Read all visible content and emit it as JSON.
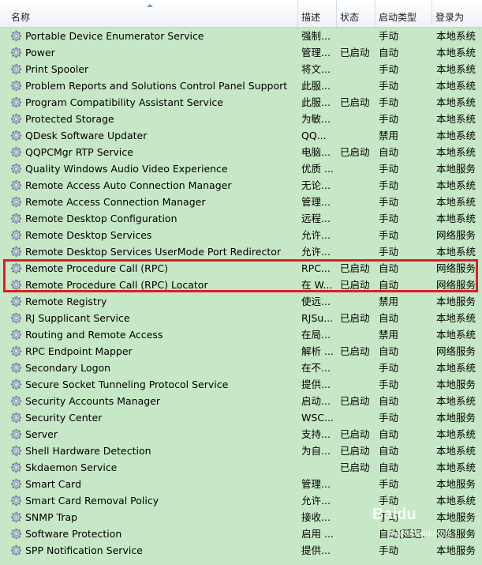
{
  "columns": {
    "name": "名称",
    "desc": "描述",
    "status": "状态",
    "startup": "启动类型",
    "logon": "登录为"
  },
  "rows": [
    {
      "name": "Portable Device Enumerator Service",
      "desc": "强制...",
      "status": "",
      "startup": "手动",
      "logon": "本地系统"
    },
    {
      "name": "Power",
      "desc": "管理...",
      "status": "已启动",
      "startup": "自动",
      "logon": "本地系统"
    },
    {
      "name": "Print Spooler",
      "desc": "将文...",
      "status": "",
      "startup": "手动",
      "logon": "本地系统"
    },
    {
      "name": "Problem Reports and Solutions Control Panel Support",
      "desc": "此服...",
      "status": "",
      "startup": "手动",
      "logon": "本地系统"
    },
    {
      "name": "Program Compatibility Assistant Service",
      "desc": "此服...",
      "status": "已启动",
      "startup": "手动",
      "logon": "本地系统"
    },
    {
      "name": "Protected Storage",
      "desc": "为敏...",
      "status": "",
      "startup": "手动",
      "logon": "本地系统"
    },
    {
      "name": "QDesk Software Updater",
      "desc": "QQ...",
      "status": "",
      "startup": "禁用",
      "logon": "本地系统"
    },
    {
      "name": "QQPCMgr RTP Service",
      "desc": "电脑...",
      "status": "已启动",
      "startup": "自动",
      "logon": "本地系统"
    },
    {
      "name": "Quality Windows Audio Video Experience",
      "desc": "优质 ...",
      "status": "",
      "startup": "手动",
      "logon": "本地服务"
    },
    {
      "name": "Remote Access Auto Connection Manager",
      "desc": "无论...",
      "status": "",
      "startup": "手动",
      "logon": "本地系统"
    },
    {
      "name": "Remote Access Connection Manager",
      "desc": "管理...",
      "status": "",
      "startup": "手动",
      "logon": "本地系统"
    },
    {
      "name": "Remote Desktop Configuration",
      "desc": "远程...",
      "status": "",
      "startup": "手动",
      "logon": "本地系统"
    },
    {
      "name": "Remote Desktop Services",
      "desc": "允许...",
      "status": "",
      "startup": "手动",
      "logon": "网络服务"
    },
    {
      "name": "Remote Desktop Services UserMode Port Redirector",
      "desc": "允许...",
      "status": "",
      "startup": "手动",
      "logon": "本地系统"
    },
    {
      "name": "Remote Procedure Call (RPC)",
      "desc": "RPC...",
      "status": "已启动",
      "startup": "自动",
      "logon": "网络服务"
    },
    {
      "name": "Remote Procedure Call (RPC) Locator",
      "desc": "在 W...",
      "status": "已启动",
      "startup": "自动",
      "logon": "网络服务"
    },
    {
      "name": "Remote Registry",
      "desc": "使远...",
      "status": "",
      "startup": "禁用",
      "logon": "本地服务"
    },
    {
      "name": "RJ Supplicant Service",
      "desc": "RJSu...",
      "status": "已启动",
      "startup": "自动",
      "logon": "本地系统"
    },
    {
      "name": "Routing and Remote Access",
      "desc": "在局...",
      "status": "",
      "startup": "禁用",
      "logon": "本地系统"
    },
    {
      "name": "RPC Endpoint Mapper",
      "desc": "解析 ...",
      "status": "已启动",
      "startup": "自动",
      "logon": "网络服务"
    },
    {
      "name": "Secondary Logon",
      "desc": "在不...",
      "status": "",
      "startup": "手动",
      "logon": "本地系统"
    },
    {
      "name": "Secure Socket Tunneling Protocol Service",
      "desc": "提供...",
      "status": "",
      "startup": "手动",
      "logon": "本地服务"
    },
    {
      "name": "Security Accounts Manager",
      "desc": "启动...",
      "status": "已启动",
      "startup": "自动",
      "logon": "本地系统"
    },
    {
      "name": "Security Center",
      "desc": "WSC...",
      "status": "",
      "startup": "手动",
      "logon": "本地服务"
    },
    {
      "name": "Server",
      "desc": "支持...",
      "status": "已启动",
      "startup": "自动",
      "logon": "本地系统"
    },
    {
      "name": "Shell Hardware Detection",
      "desc": "为自...",
      "status": "已启动",
      "startup": "自动",
      "logon": "本地系统"
    },
    {
      "name": "Skdaemon Service",
      "desc": "",
      "status": "已启动",
      "startup": "自动",
      "logon": "本地系统"
    },
    {
      "name": "Smart Card",
      "desc": "管理...",
      "status": "",
      "startup": "手动",
      "logon": "本地服务"
    },
    {
      "name": "Smart Card Removal Policy",
      "desc": "允许...",
      "status": "",
      "startup": "手动",
      "logon": "本地系统"
    },
    {
      "name": "SNMP Trap",
      "desc": "接收...",
      "status": "",
      "startup": "手动",
      "logon": "本地服务"
    },
    {
      "name": "Software Protection",
      "desc": "启用 ...",
      "status": "",
      "startup": "自动(延迟...",
      "logon": "网络服务"
    },
    {
      "name": "SPP Notification Service",
      "desc": "提供...",
      "status": "",
      "startup": "手动",
      "logon": "本地服务"
    }
  ],
  "colors": {
    "background": "#c6e8c6",
    "highlight_border": "#e21c24",
    "header_bg": "#ffffff"
  },
  "icon": "gear-icon",
  "watermark": {
    "text": "Baidu",
    "sub": "jingyan.baidu.com"
  }
}
